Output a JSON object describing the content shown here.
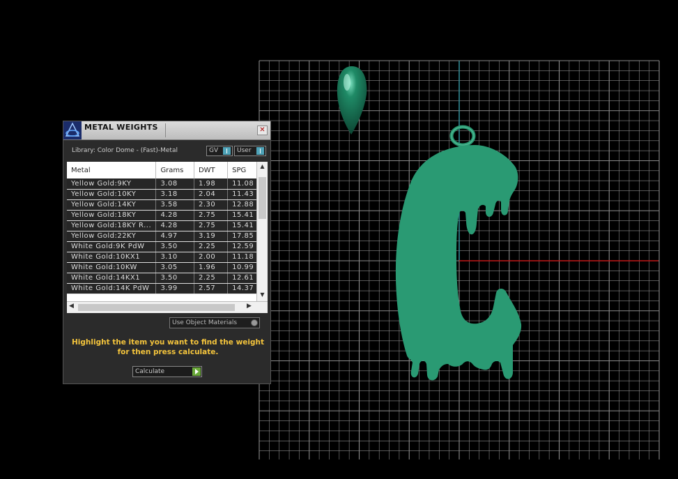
{
  "panel": {
    "title": "METAL WEIGHTS",
    "close_glyph": "✕",
    "library_label": "Library: Color Dome - (Fast)-Metal",
    "toggles": {
      "gv": "GV",
      "user": "User"
    },
    "columns": [
      "Metal",
      "Grams",
      "DWT",
      "SPG"
    ],
    "rows": [
      [
        "Yellow Gold:9KY",
        "3.08",
        "1.98",
        "11.08"
      ],
      [
        "Yellow Gold:10KY",
        "3.18",
        "2.04",
        "11.43"
      ],
      [
        "Yellow Gold:14KY",
        "3.58",
        "2.30",
        "12.88"
      ],
      [
        "Yellow Gold:18KY",
        "4.28",
        "2.75",
        "15.41"
      ],
      [
        "Yellow Gold:18KY R...",
        "4.28",
        "2.75",
        "15.41"
      ],
      [
        "Yellow Gold:22KY",
        "4.97",
        "3.19",
        "17.85"
      ],
      [
        "White Gold:9K PdW",
        "3.50",
        "2.25",
        "12.59"
      ],
      [
        "White Gold:10KX1",
        "3.10",
        "2.00",
        "11.18"
      ],
      [
        "White Gold:10KW",
        "3.05",
        "1.96",
        "10.99"
      ],
      [
        "White Gold:14KX1",
        "3.50",
        "2.25",
        "12.61"
      ],
      [
        "White Gold:14K PdW",
        "3.99",
        "2.57",
        "14.37"
      ]
    ],
    "use_object_materials": "Use Object Materials",
    "instructions_line1": "Highlight the item you want to find the weight",
    "instructions_line2": "for then press calculate.",
    "calculate_label": "Calculate"
  },
  "colors": {
    "model": "#2a9a73",
    "grid": "#8a8a8a",
    "axis_x": "#c21818",
    "axis_y": "#2e8c95",
    "instructions": "#f4c43c"
  },
  "icons": {
    "logo": "rhino-matrix-logo-icon",
    "close": "close-icon",
    "scroll_up": "scroll-up-arrow-icon",
    "scroll_down": "scroll-down-arrow-icon",
    "scroll_left": "scroll-left-arrow-icon",
    "scroll_right": "scroll-right-arrow-icon",
    "calculate": "play-arrow-icon"
  }
}
